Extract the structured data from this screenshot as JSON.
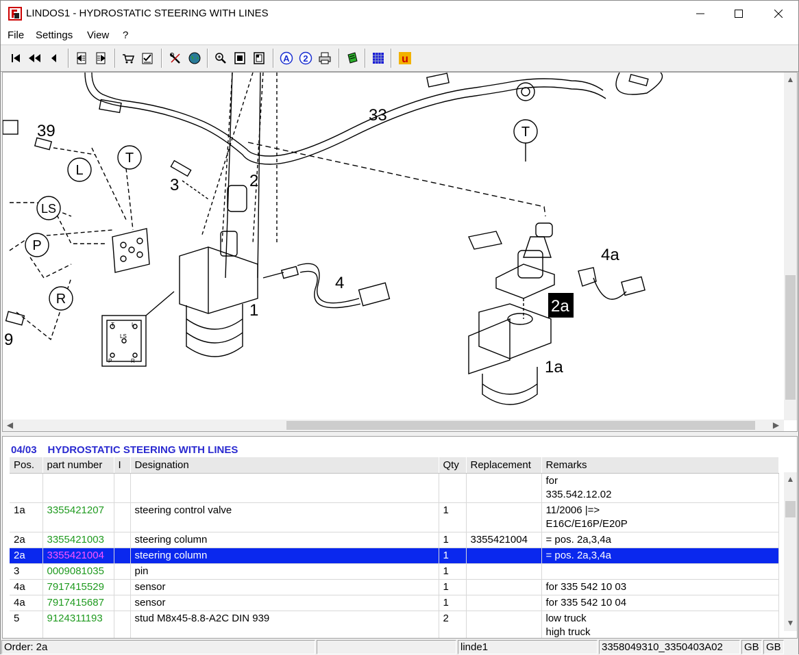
{
  "window": {
    "title": "LINDOS1 - HYDROSTATIC STEERING WITH LINES"
  },
  "menu": {
    "items": [
      "File",
      "Settings",
      "View",
      "?"
    ]
  },
  "toolbar": {
    "icons": [
      "first-page-icon",
      "previous-group-icon",
      "previous-icon",
      "back-section-icon",
      "forward-section-icon",
      "cart-icon",
      "order-list-icon",
      "tools-icon",
      "globe-icon",
      "zoom-icon",
      "page-icon",
      "page-alt-icon",
      "info-a-icon",
      "info-2-icon",
      "print-icon",
      "export-icon",
      "grid-icon",
      "u-icon"
    ]
  },
  "drawing": {
    "callouts": [
      "39",
      "L",
      "T",
      "3",
      "2",
      "33",
      "T",
      "LS",
      "P",
      "R",
      "1",
      "4",
      "4a",
      "2a",
      "1a",
      "9"
    ],
    "port_labels": {
      "t": "T",
      "l": "L",
      "ls": "LS",
      "p": "P",
      "r": "R"
    }
  },
  "parts": {
    "section_code": "04/03",
    "section_title": "HYDROSTATIC STEERING WITH LINES",
    "columns": [
      "Pos.",
      "part number",
      "I",
      "Designation",
      "Qty",
      "Replacement",
      "Remarks"
    ],
    "rows": [
      {
        "pos": "",
        "part_number": "",
        "i": "",
        "designation": "",
        "qty": "",
        "replacement": "",
        "remarks": [
          "for",
          "335.542.12.02"
        ]
      },
      {
        "pos": "1a",
        "part_number": "3355421207",
        "i": "",
        "designation": "steering control valve",
        "qty": "1",
        "replacement": "",
        "remarks": [
          "11/2006 |=>",
          "E16C/E16P/E20P"
        ]
      },
      {
        "pos": "2a",
        "part_number": "3355421003",
        "i": "",
        "designation": "steering column",
        "qty": "1",
        "replacement": "3355421004",
        "remarks": [
          "= pos. 2a,3,4a"
        ]
      },
      {
        "pos": "2a",
        "part_number": "3355421004",
        "i": "",
        "designation": "steering column",
        "qty": "1",
        "replacement": "",
        "remarks": [
          "= pos. 2a,3,4a"
        ],
        "selected": true
      },
      {
        "pos": "3",
        "part_number": "0009081035",
        "i": "",
        "designation": "pin",
        "qty": "1",
        "replacement": "",
        "remarks": [
          ""
        ]
      },
      {
        "pos": "4a",
        "part_number": "7917415529",
        "i": "",
        "designation": "sensor",
        "qty": "1",
        "replacement": "",
        "remarks": [
          "for 335 542 10 03"
        ]
      },
      {
        "pos": "4a",
        "part_number": "7917415687",
        "i": "",
        "designation": "sensor",
        "qty": "1",
        "replacement": "",
        "remarks": [
          "for 335 542 10 04"
        ]
      },
      {
        "pos": "5",
        "part_number": "9124311193",
        "i": "",
        "designation": "stud M8x45-8.8-A2C  DIN 939",
        "qty": "2",
        "replacement": "",
        "remarks": [
          "low truck",
          "high truck"
        ]
      }
    ]
  },
  "status": {
    "order": "Order: 2a",
    "blank": "",
    "user": "linde1",
    "doc_ref": "3358049310_3350403A02",
    "lang1": "GB",
    "lang2": "GB"
  },
  "colors": {
    "header_blue": "#2a2ad0",
    "part_number_green": "#1f9a1f",
    "selection_blue": "#0a28ee",
    "selected_part_magenta": "#ff55ff"
  }
}
